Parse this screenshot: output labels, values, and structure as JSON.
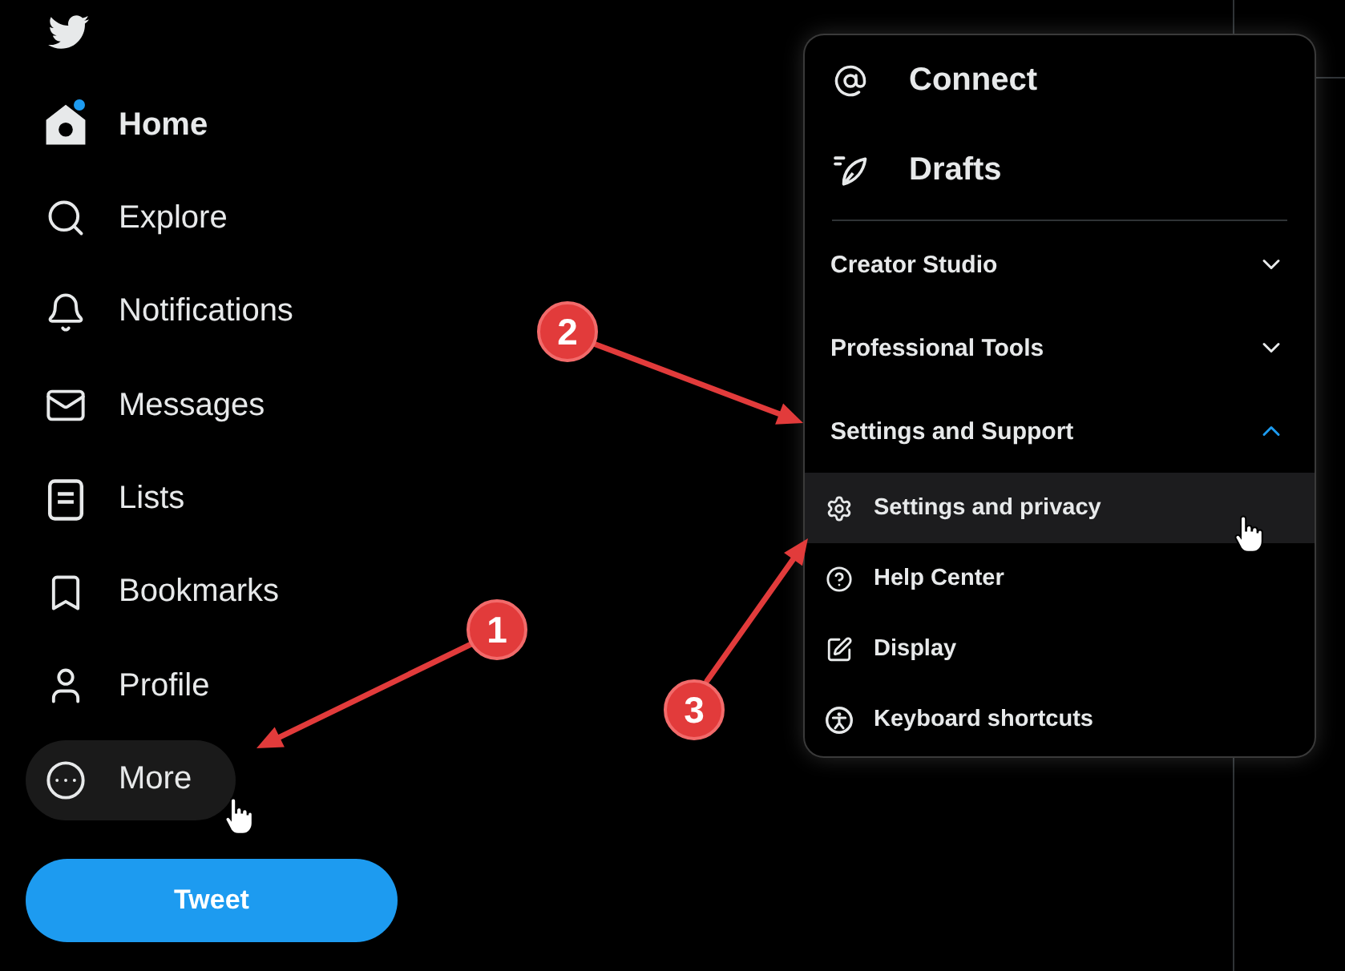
{
  "sidebar": {
    "items": [
      {
        "label": "Home",
        "selected": true,
        "unread": true,
        "highlighted": false
      },
      {
        "label": "Explore",
        "selected": false,
        "unread": false,
        "highlighted": false
      },
      {
        "label": "Notifications",
        "selected": false,
        "unread": false,
        "highlighted": false
      },
      {
        "label": "Messages",
        "selected": false,
        "unread": false,
        "highlighted": false
      },
      {
        "label": "Lists",
        "selected": false,
        "unread": false,
        "highlighted": false
      },
      {
        "label": "Bookmarks",
        "selected": false,
        "unread": false,
        "highlighted": false
      },
      {
        "label": "Profile",
        "selected": false,
        "unread": false,
        "highlighted": false
      },
      {
        "label": "More",
        "selected": false,
        "unread": false,
        "highlighted": true
      }
    ],
    "tweet_button": {
      "label": "Tweet"
    }
  },
  "menu": {
    "items": [
      {
        "label": "Connect"
      },
      {
        "label": "Drafts"
      }
    ],
    "sections": [
      {
        "label": "Creator Studio",
        "expanded": false
      },
      {
        "label": "Professional Tools",
        "expanded": false
      },
      {
        "label": "Settings and Support",
        "expanded": true,
        "children": [
          {
            "label": "Settings and privacy",
            "highlighted": true
          },
          {
            "label": "Help Center",
            "highlighted": false
          },
          {
            "label": "Display",
            "highlighted": false
          },
          {
            "label": "Keyboard shortcuts",
            "highlighted": false
          }
        ]
      }
    ]
  },
  "annotations": [
    {
      "label": "1"
    },
    {
      "label": "2"
    },
    {
      "label": "3"
    }
  ]
}
